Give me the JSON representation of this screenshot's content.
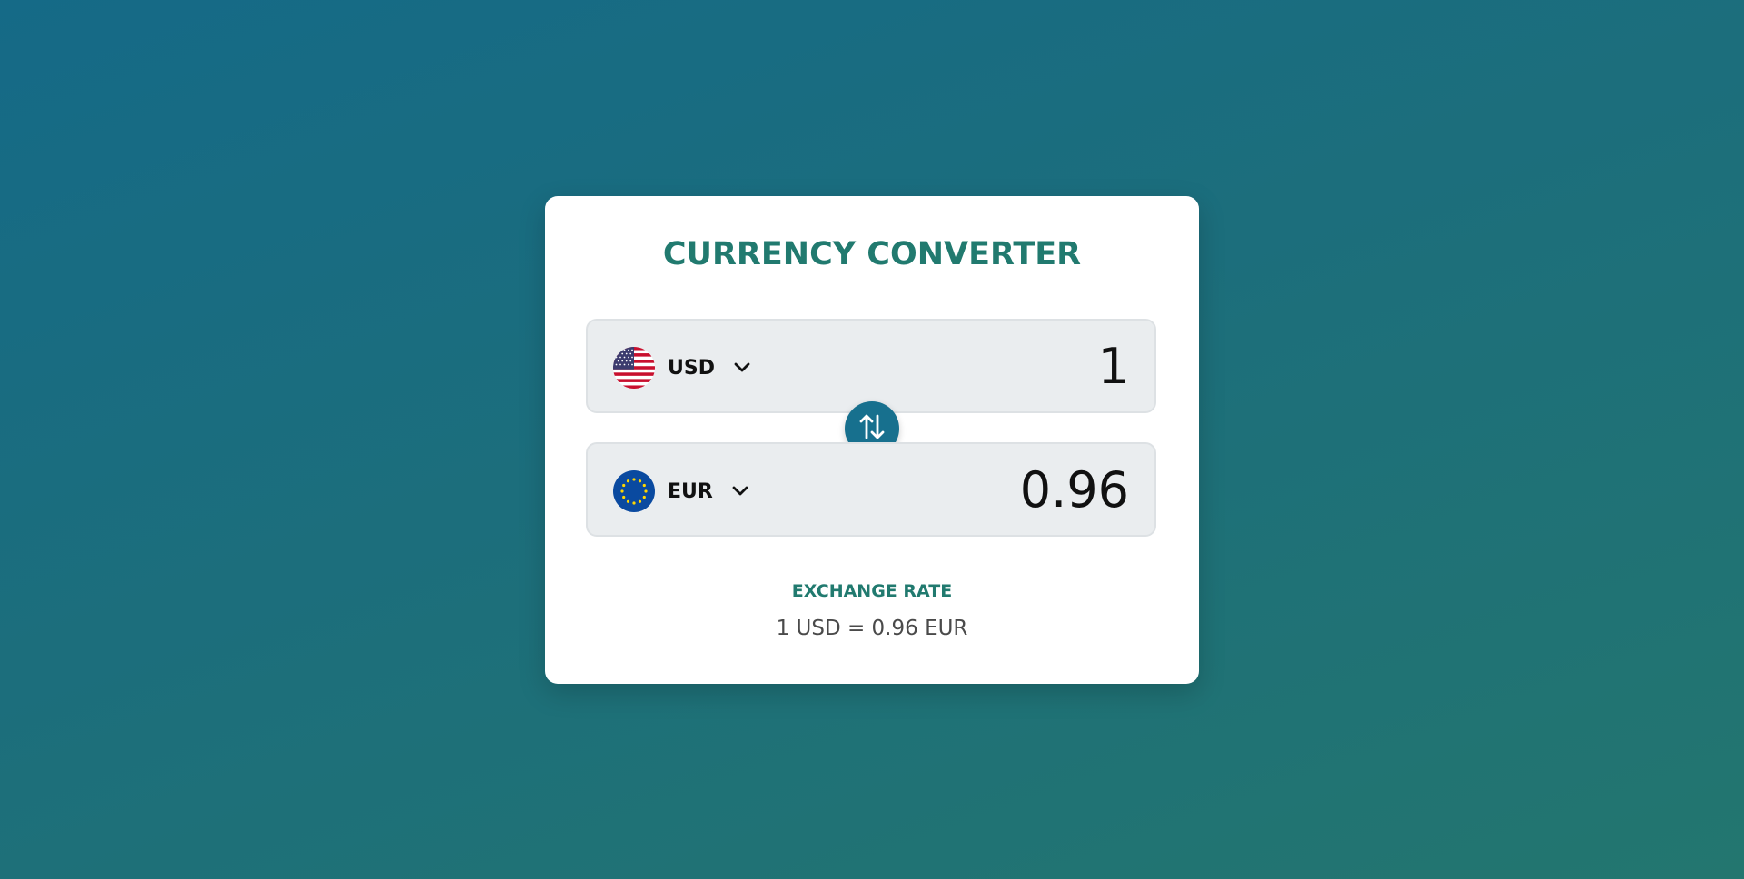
{
  "app": {
    "title": "CURRENCY CONVERTER"
  },
  "from": {
    "currency_code": "USD",
    "amount": "1",
    "flag_icon": "us-flag-icon"
  },
  "to": {
    "currency_code": "EUR",
    "amount": "0.96",
    "flag_icon": "eu-flag-icon"
  },
  "swap": {
    "icon": "swap-arrows-icon"
  },
  "exchange_rate": {
    "label": "EXCHANGE RATE",
    "value": "1 USD = 0.96 EUR"
  },
  "colors": {
    "accent": "#217a6f",
    "swap_button": "#17708e",
    "background_start": "#156a87",
    "background_end": "#23766f"
  }
}
